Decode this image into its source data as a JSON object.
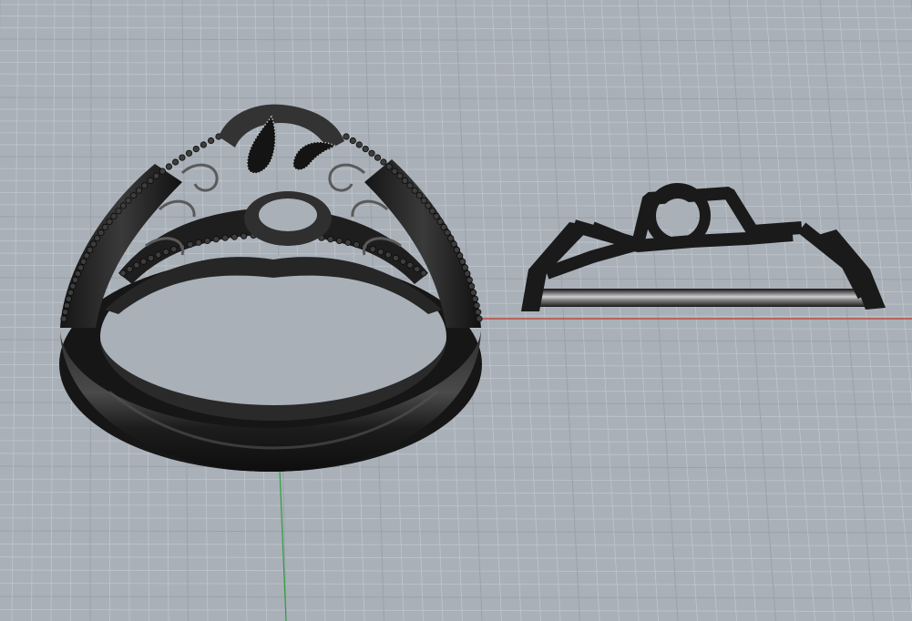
{
  "viewport": {
    "projection": "perspective",
    "background_color": "#a9b0b8",
    "grid_minor_color": "#bfc5cc",
    "grid_major_color": "#9aa1a9",
    "axis_x_color": "#c0392b",
    "axis_y_color": "#2e9e3e",
    "show_grid": true,
    "show_axes": true
  },
  "objects": [
    {
      "name": "ring-model",
      "material": "dark-metal"
    },
    {
      "name": "ring-head-profile",
      "material": "dark-metal"
    }
  ]
}
